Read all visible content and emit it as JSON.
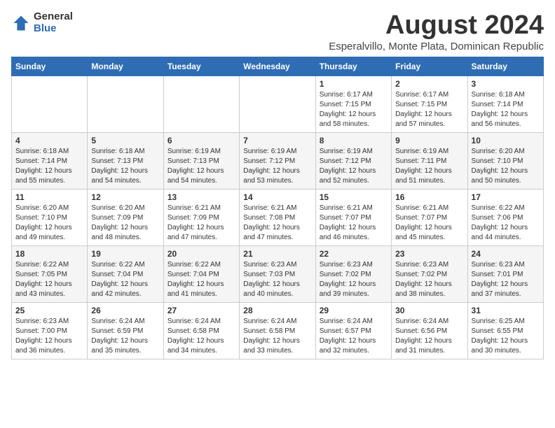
{
  "logo": {
    "general": "General",
    "blue": "Blue"
  },
  "header": {
    "month": "August 2024",
    "location": "Esperalvillo, Monte Plata, Dominican Republic"
  },
  "weekdays": [
    "Sunday",
    "Monday",
    "Tuesday",
    "Wednesday",
    "Thursday",
    "Friday",
    "Saturday"
  ],
  "weeks": [
    [
      {
        "day": "",
        "info": ""
      },
      {
        "day": "",
        "info": ""
      },
      {
        "day": "",
        "info": ""
      },
      {
        "day": "",
        "info": ""
      },
      {
        "day": "1",
        "info": "Sunrise: 6:17 AM\nSunset: 7:15 PM\nDaylight: 12 hours\nand 58 minutes."
      },
      {
        "day": "2",
        "info": "Sunrise: 6:17 AM\nSunset: 7:15 PM\nDaylight: 12 hours\nand 57 minutes."
      },
      {
        "day": "3",
        "info": "Sunrise: 6:18 AM\nSunset: 7:14 PM\nDaylight: 12 hours\nand 56 minutes."
      }
    ],
    [
      {
        "day": "4",
        "info": "Sunrise: 6:18 AM\nSunset: 7:14 PM\nDaylight: 12 hours\nand 55 minutes."
      },
      {
        "day": "5",
        "info": "Sunrise: 6:18 AM\nSunset: 7:13 PM\nDaylight: 12 hours\nand 54 minutes."
      },
      {
        "day": "6",
        "info": "Sunrise: 6:19 AM\nSunset: 7:13 PM\nDaylight: 12 hours\nand 54 minutes."
      },
      {
        "day": "7",
        "info": "Sunrise: 6:19 AM\nSunset: 7:12 PM\nDaylight: 12 hours\nand 53 minutes."
      },
      {
        "day": "8",
        "info": "Sunrise: 6:19 AM\nSunset: 7:12 PM\nDaylight: 12 hours\nand 52 minutes."
      },
      {
        "day": "9",
        "info": "Sunrise: 6:19 AM\nSunset: 7:11 PM\nDaylight: 12 hours\nand 51 minutes."
      },
      {
        "day": "10",
        "info": "Sunrise: 6:20 AM\nSunset: 7:10 PM\nDaylight: 12 hours\nand 50 minutes."
      }
    ],
    [
      {
        "day": "11",
        "info": "Sunrise: 6:20 AM\nSunset: 7:10 PM\nDaylight: 12 hours\nand 49 minutes."
      },
      {
        "day": "12",
        "info": "Sunrise: 6:20 AM\nSunset: 7:09 PM\nDaylight: 12 hours\nand 48 minutes."
      },
      {
        "day": "13",
        "info": "Sunrise: 6:21 AM\nSunset: 7:09 PM\nDaylight: 12 hours\nand 47 minutes."
      },
      {
        "day": "14",
        "info": "Sunrise: 6:21 AM\nSunset: 7:08 PM\nDaylight: 12 hours\nand 47 minutes."
      },
      {
        "day": "15",
        "info": "Sunrise: 6:21 AM\nSunset: 7:07 PM\nDaylight: 12 hours\nand 46 minutes."
      },
      {
        "day": "16",
        "info": "Sunrise: 6:21 AM\nSunset: 7:07 PM\nDaylight: 12 hours\nand 45 minutes."
      },
      {
        "day": "17",
        "info": "Sunrise: 6:22 AM\nSunset: 7:06 PM\nDaylight: 12 hours\nand 44 minutes."
      }
    ],
    [
      {
        "day": "18",
        "info": "Sunrise: 6:22 AM\nSunset: 7:05 PM\nDaylight: 12 hours\nand 43 minutes."
      },
      {
        "day": "19",
        "info": "Sunrise: 6:22 AM\nSunset: 7:04 PM\nDaylight: 12 hours\nand 42 minutes."
      },
      {
        "day": "20",
        "info": "Sunrise: 6:22 AM\nSunset: 7:04 PM\nDaylight: 12 hours\nand 41 minutes."
      },
      {
        "day": "21",
        "info": "Sunrise: 6:23 AM\nSunset: 7:03 PM\nDaylight: 12 hours\nand 40 minutes."
      },
      {
        "day": "22",
        "info": "Sunrise: 6:23 AM\nSunset: 7:02 PM\nDaylight: 12 hours\nand 39 minutes."
      },
      {
        "day": "23",
        "info": "Sunrise: 6:23 AM\nSunset: 7:02 PM\nDaylight: 12 hours\nand 38 minutes."
      },
      {
        "day": "24",
        "info": "Sunrise: 6:23 AM\nSunset: 7:01 PM\nDaylight: 12 hours\nand 37 minutes."
      }
    ],
    [
      {
        "day": "25",
        "info": "Sunrise: 6:23 AM\nSunset: 7:00 PM\nDaylight: 12 hours\nand 36 minutes."
      },
      {
        "day": "26",
        "info": "Sunrise: 6:24 AM\nSunset: 6:59 PM\nDaylight: 12 hours\nand 35 minutes."
      },
      {
        "day": "27",
        "info": "Sunrise: 6:24 AM\nSunset: 6:58 PM\nDaylight: 12 hours\nand 34 minutes."
      },
      {
        "day": "28",
        "info": "Sunrise: 6:24 AM\nSunset: 6:58 PM\nDaylight: 12 hours\nand 33 minutes."
      },
      {
        "day": "29",
        "info": "Sunrise: 6:24 AM\nSunset: 6:57 PM\nDaylight: 12 hours\nand 32 minutes."
      },
      {
        "day": "30",
        "info": "Sunrise: 6:24 AM\nSunset: 6:56 PM\nDaylight: 12 hours\nand 31 minutes."
      },
      {
        "day": "31",
        "info": "Sunrise: 6:25 AM\nSunset: 6:55 PM\nDaylight: 12 hours\nand 30 minutes."
      }
    ]
  ]
}
